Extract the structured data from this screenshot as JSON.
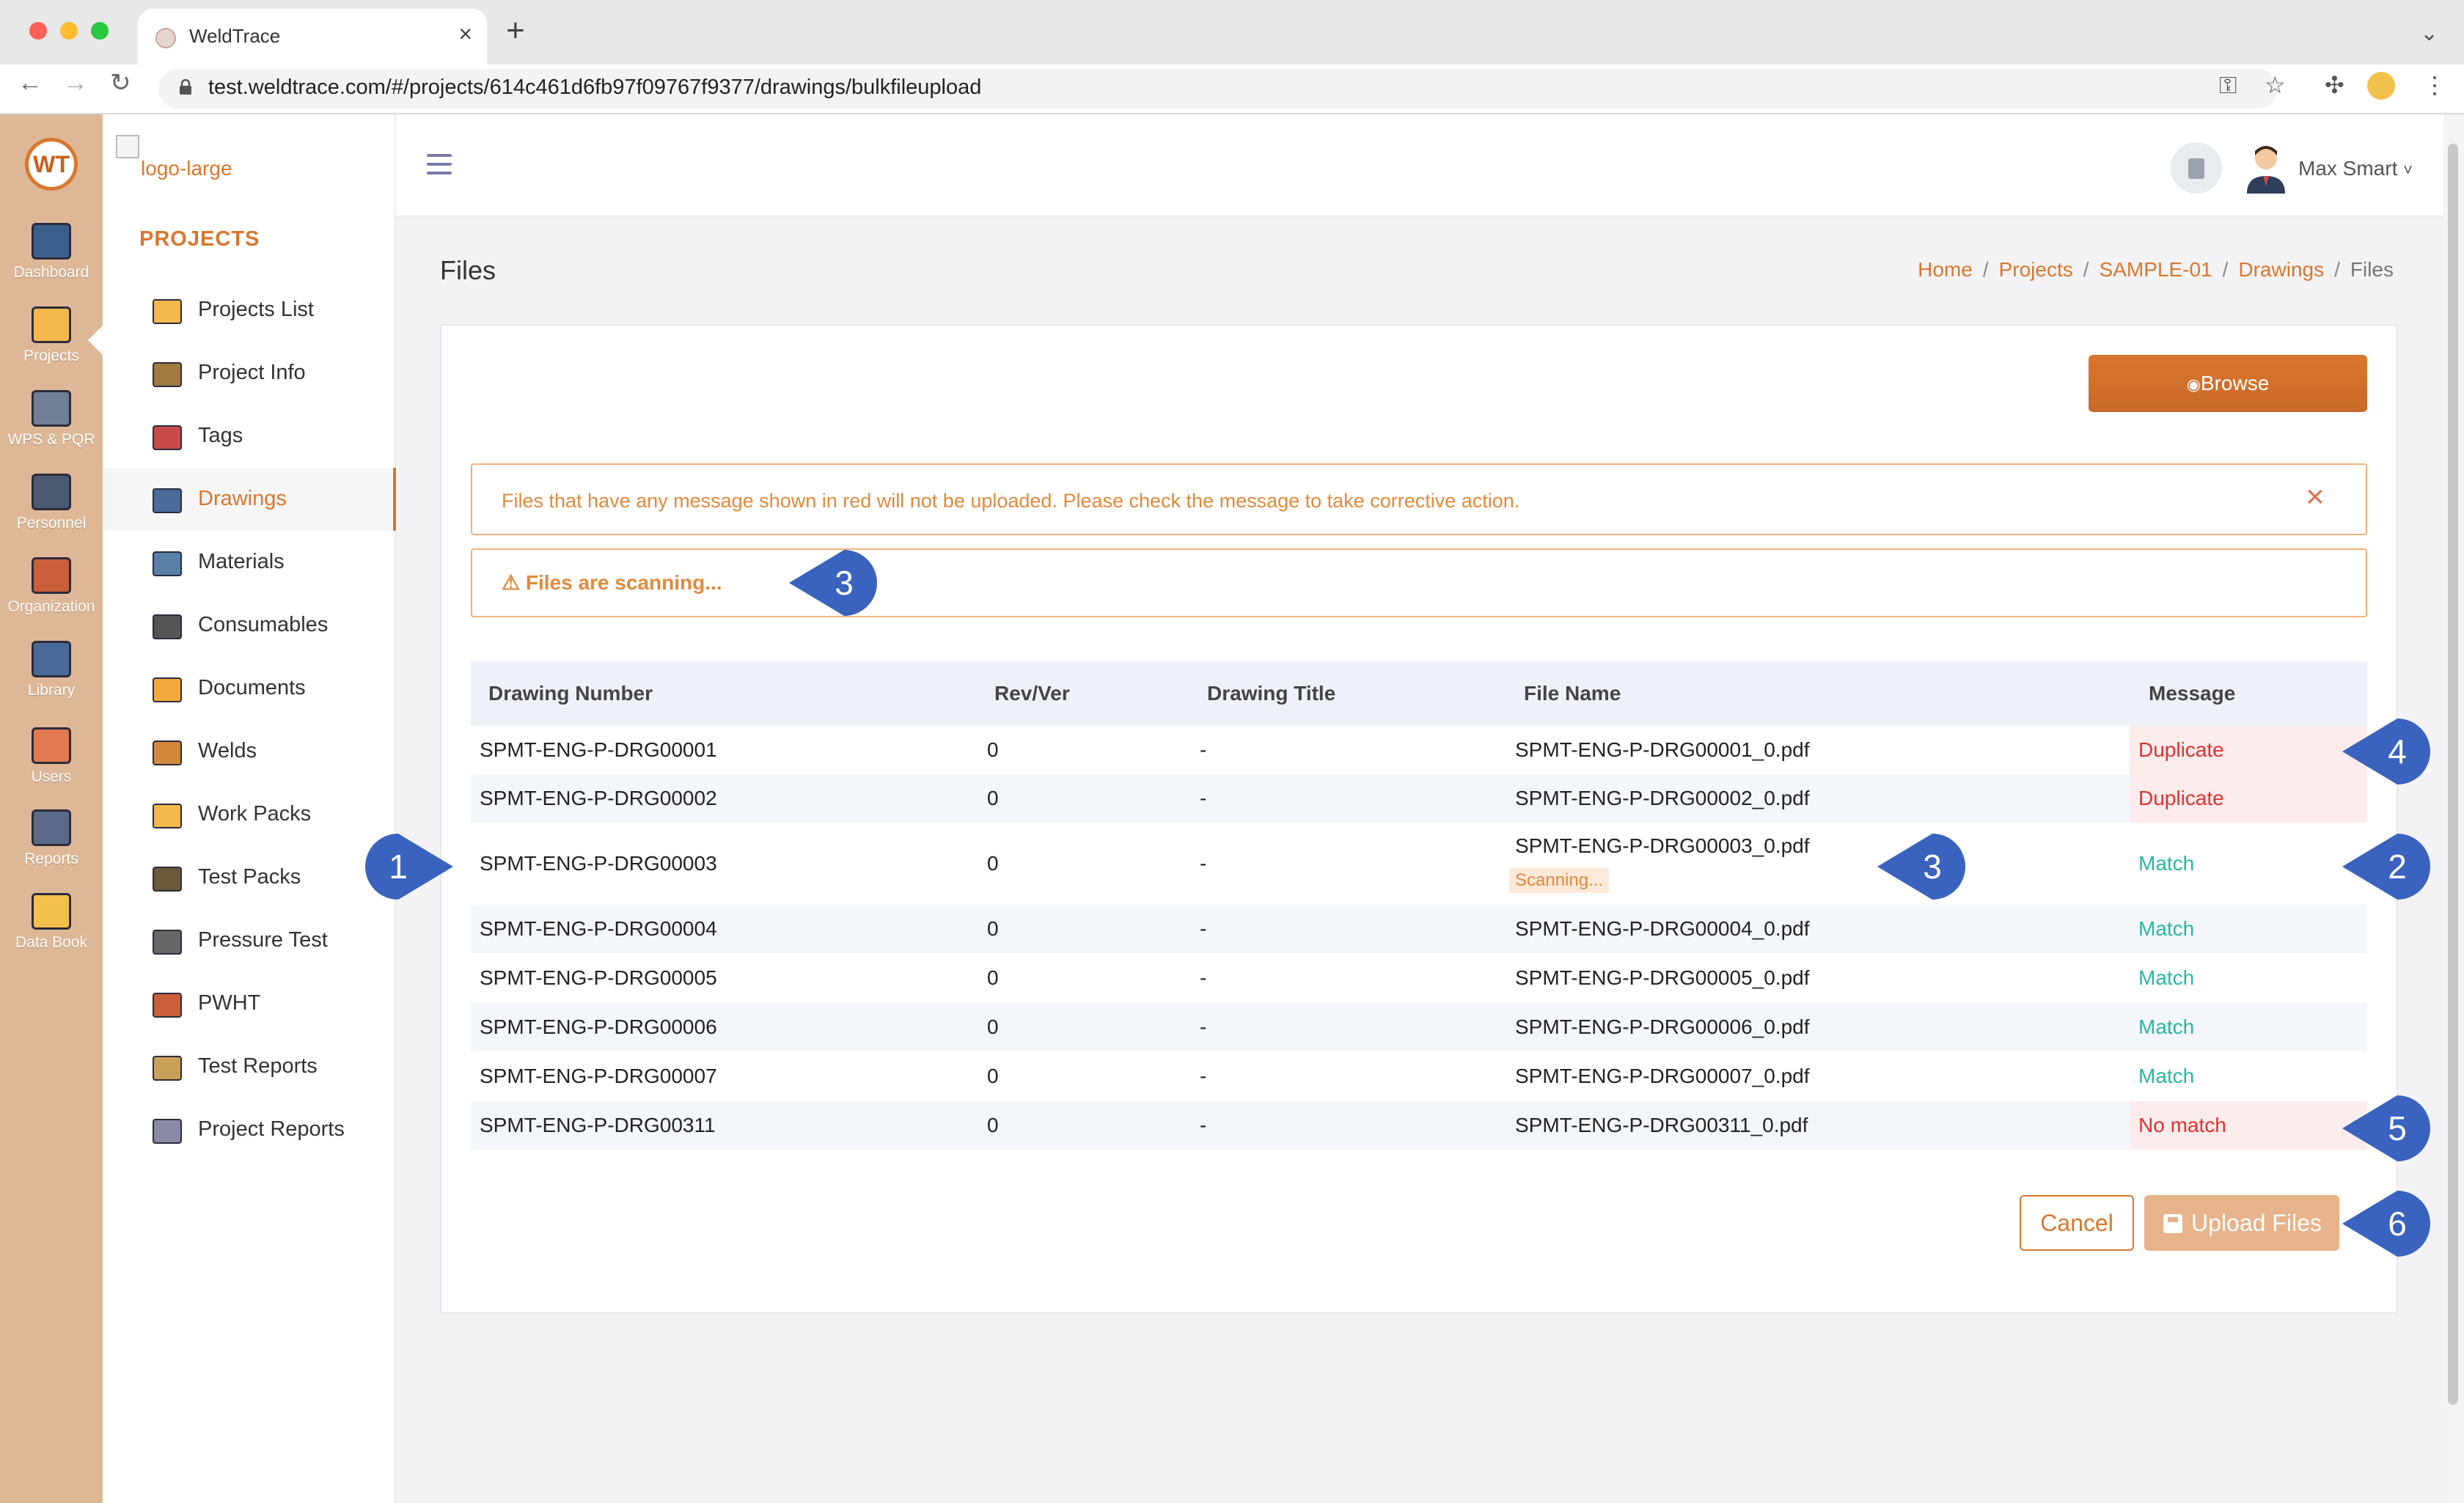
{
  "browser": {
    "tab_title": "WeldTrace",
    "url": "test.weldtrace.com/#/projects/614c461d6fb97f09767f9377/drawings/bulkfileupload"
  },
  "rail": {
    "logo": "WT",
    "items": [
      {
        "label": "Dashboard",
        "icon": "dashboard-icon",
        "color": "#3a5f8a"
      },
      {
        "label": "Projects",
        "icon": "projects-folder-icon",
        "color": "#f2b84b"
      },
      {
        "label": "WPS & PQR",
        "icon": "wps-pqr-icon",
        "color": "#6f7f96"
      },
      {
        "label": "Personnel",
        "icon": "welder-personnel-icon",
        "color": "#4a5a72"
      },
      {
        "label": "Organization",
        "icon": "organization-icon",
        "color": "#c9603b"
      },
      {
        "label": "Library",
        "icon": "library-icon",
        "color": "#4a6a9a"
      },
      {
        "label": "Users",
        "icon": "users-icon",
        "color": "#e07a50"
      },
      {
        "label": "Reports",
        "icon": "reports-icon",
        "color": "#5a6a88"
      },
      {
        "label": "Data Book",
        "icon": "data-book-icon",
        "color": "#f2c14b"
      }
    ]
  },
  "sidebar": {
    "brand_alt": "logo-large",
    "section_title": "PROJECTS",
    "items": [
      {
        "label": "Projects List",
        "icon": "projects-list-icon",
        "color": "#f2b84b"
      },
      {
        "label": "Project Info",
        "icon": "project-info-icon",
        "color": "#a07a40"
      },
      {
        "label": "Tags",
        "icon": "tag-icon",
        "color": "#c94a4a"
      },
      {
        "label": "Drawings",
        "icon": "drawings-icon",
        "color": "#4a6a9a"
      },
      {
        "label": "Materials",
        "icon": "materials-icon",
        "color": "#5a7fa8"
      },
      {
        "label": "Consumables",
        "icon": "consumables-icon",
        "color": "#555555"
      },
      {
        "label": "Documents",
        "icon": "documents-icon",
        "color": "#f2a83b"
      },
      {
        "label": "Welds",
        "icon": "welds-icon",
        "color": "#d0883b"
      },
      {
        "label": "Work Packs",
        "icon": "work-packs-icon",
        "color": "#f2b84b"
      },
      {
        "label": "Test Packs",
        "icon": "test-packs-icon",
        "color": "#6a5a3a"
      },
      {
        "label": "Pressure Test",
        "icon": "pressure-test-icon",
        "color": "#666666"
      },
      {
        "label": "PWHT",
        "icon": "pwht-icon",
        "color": "#c9603b"
      },
      {
        "label": "Test Reports",
        "icon": "test-reports-icon",
        "color": "#c9a05a"
      },
      {
        "label": "Project Reports",
        "icon": "project-reports-icon",
        "color": "#8a8aa8"
      }
    ]
  },
  "header": {
    "user_name": "Max Smart",
    "user_caret": "˅"
  },
  "page": {
    "title": "Files",
    "breadcrumb": [
      "Home",
      "Projects",
      "SAMPLE-01",
      "Drawings"
    ],
    "breadcrumb_current": "Files",
    "breadcrumb_sep": "/"
  },
  "card": {
    "browse_label": "Browse",
    "alert_text": "Files that have any message shown in red will not be uploaded. Please check the message to take corrective action.",
    "scan_text": "⚠ Files are scanning...",
    "columns": [
      "Drawing Number",
      "Rev/Ver",
      "Drawing Title",
      "File Name",
      "Message"
    ],
    "rows": [
      {
        "number": "SPMT-ENG-P-DRG00001",
        "rev": "0",
        "title": "-",
        "file": "SPMT-ENG-P-DRG00001_0.pdf",
        "message": "Duplicate",
        "status": "error"
      },
      {
        "number": "SPMT-ENG-P-DRG00002",
        "rev": "0",
        "title": "-",
        "file": "SPMT-ENG-P-DRG00002_0.pdf",
        "message": "Duplicate",
        "status": "error"
      },
      {
        "number": "SPMT-ENG-P-DRG00003",
        "rev": "0",
        "title": "-",
        "file": "SPMT-ENG-P-DRG00003_0.pdf",
        "message": "Match",
        "status": "ok",
        "badge": "Scanning..."
      },
      {
        "number": "SPMT-ENG-P-DRG00004",
        "rev": "0",
        "title": "-",
        "file": "SPMT-ENG-P-DRG00004_0.pdf",
        "message": "Match",
        "status": "ok"
      },
      {
        "number": "SPMT-ENG-P-DRG00005",
        "rev": "0",
        "title": "-",
        "file": "SPMT-ENG-P-DRG00005_0.pdf",
        "message": "Match",
        "status": "ok"
      },
      {
        "number": "SPMT-ENG-P-DRG00006",
        "rev": "0",
        "title": "-",
        "file": "SPMT-ENG-P-DRG00006_0.pdf",
        "message": "Match",
        "status": "ok"
      },
      {
        "number": "SPMT-ENG-P-DRG00007",
        "rev": "0",
        "title": "-",
        "file": "SPMT-ENG-P-DRG00007_0.pdf",
        "message": "Match",
        "status": "ok"
      },
      {
        "number": "SPMT-ENG-P-DRG00311",
        "rev": "0",
        "title": "-",
        "file": "SPMT-ENG-P-DRG00311_0.pdf",
        "message": "No match",
        "status": "error"
      }
    ],
    "cancel_label": "Cancel",
    "upload_label": "Upload Files"
  },
  "callouts": [
    "1",
    "2",
    "3",
    "3",
    "4",
    "5",
    "6"
  ],
  "colors": {
    "accent": "#d9772e",
    "rail_bg": "#deb896",
    "error_text": "#e03131",
    "error_bg": "#fdecec",
    "ok_text": "#2bb5a1",
    "callout": "#3a63c0"
  }
}
